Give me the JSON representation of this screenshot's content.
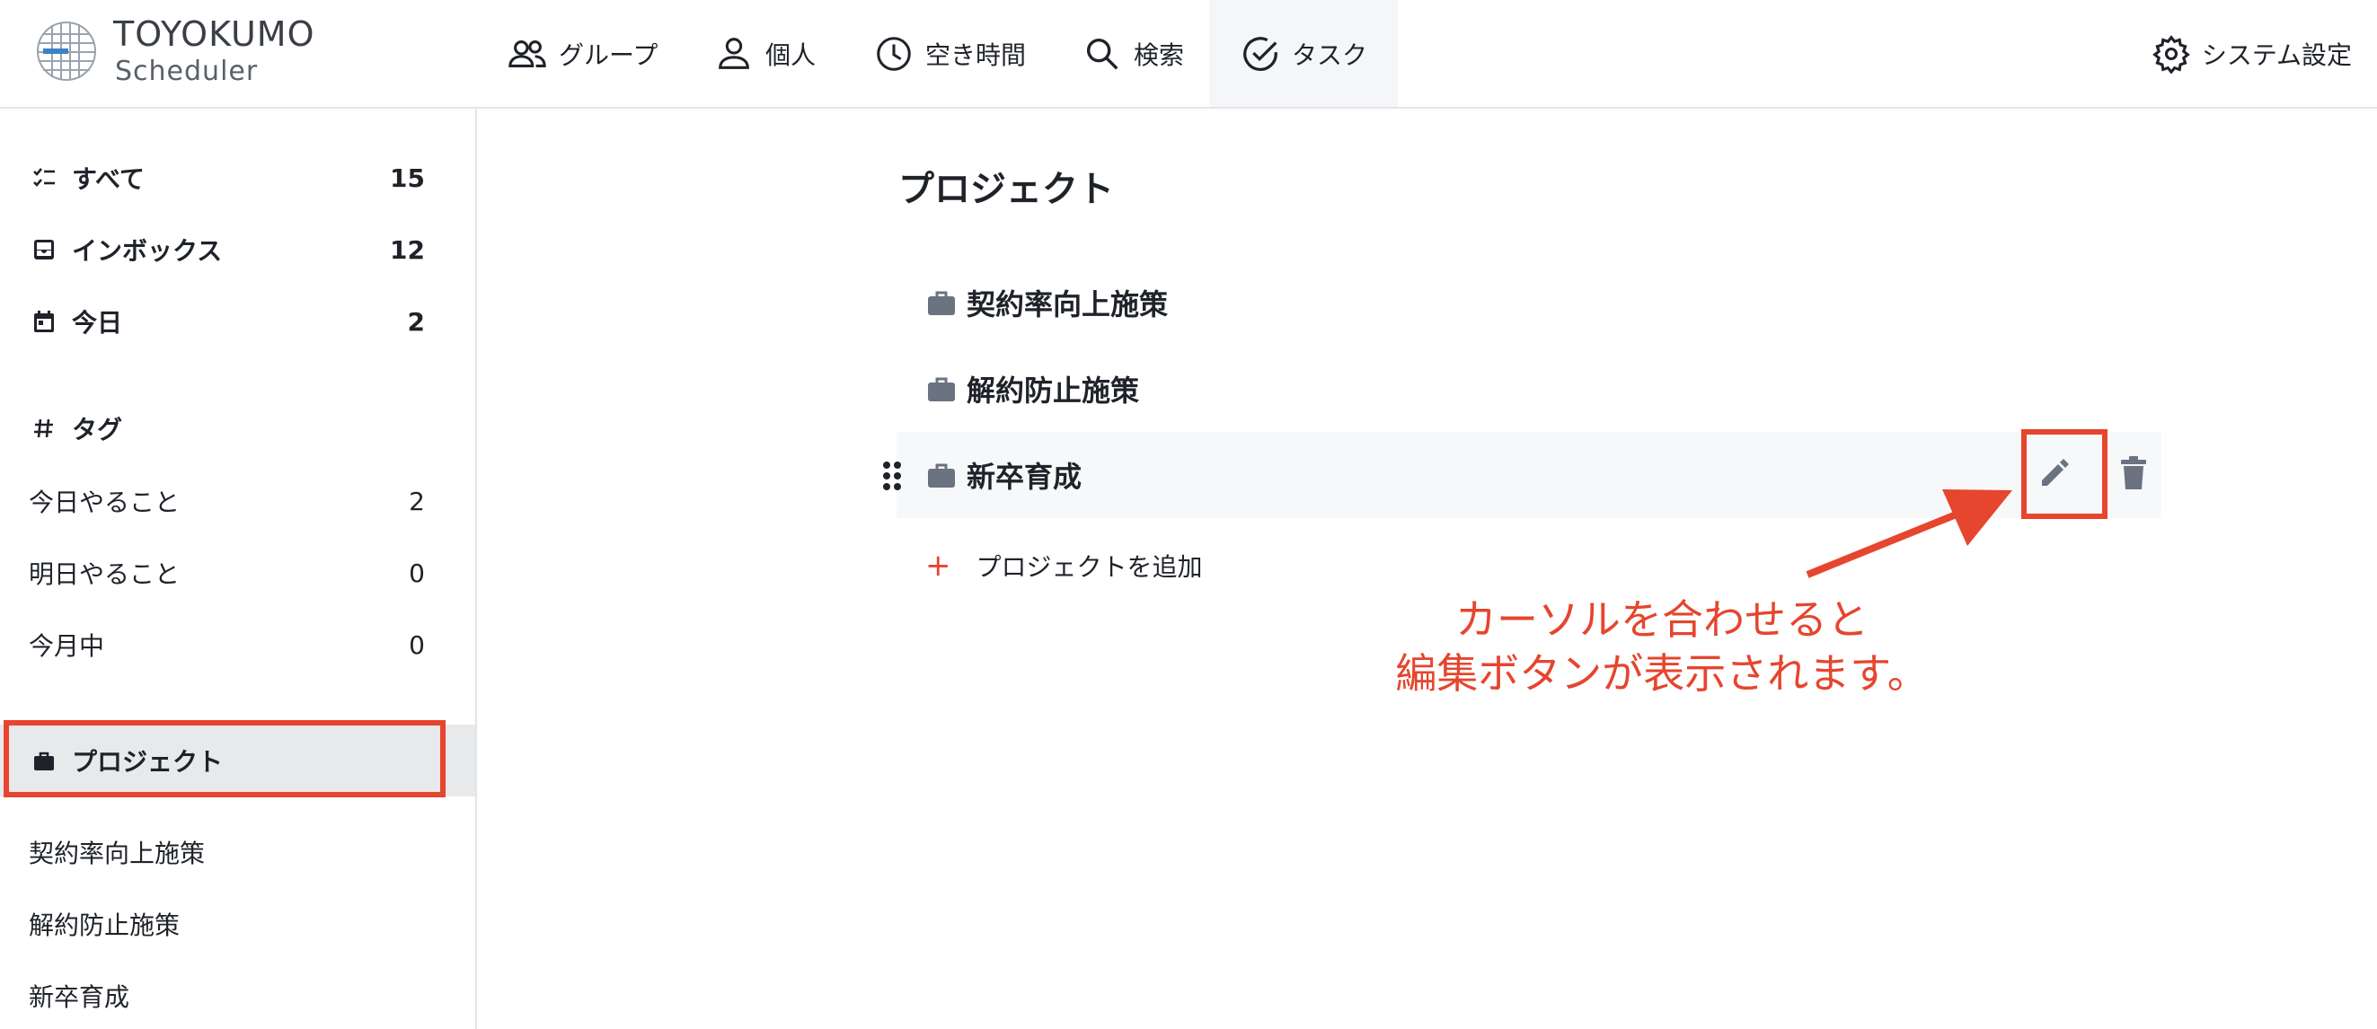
{
  "app": {
    "logo_title": "TOYOKUMO",
    "logo_subtitle": "Scheduler"
  },
  "nav": {
    "items": [
      {
        "label": "グループ",
        "icon": "group-icon"
      },
      {
        "label": "個人",
        "icon": "person-icon"
      },
      {
        "label": "空き時間",
        "icon": "clock-icon"
      },
      {
        "label": "検索",
        "icon": "search-icon"
      },
      {
        "label": "タスク",
        "icon": "check-circle-icon",
        "active": true
      }
    ],
    "settings_label": "システム設定"
  },
  "sidebar": {
    "filters": [
      {
        "label": "すべて",
        "count": "15",
        "icon": "checklist-icon"
      },
      {
        "label": "インボックス",
        "count": "12",
        "icon": "inbox-icon"
      },
      {
        "label": "今日",
        "count": "2",
        "icon": "calendar-icon"
      }
    ],
    "tags_heading": "タグ",
    "tags": [
      {
        "label": "今日やること",
        "count": "2"
      },
      {
        "label": "明日やること",
        "count": "0"
      },
      {
        "label": "今月中",
        "count": "0"
      }
    ],
    "projects_heading": "プロジェクト",
    "projects": [
      "契約率向上施策",
      "解約防止施策",
      "新卒育成"
    ]
  },
  "main": {
    "title": "プロジェクト",
    "projects": [
      "契約率向上施策",
      "解約防止施策",
      "新卒育成"
    ],
    "add_label": "プロジェクトを追加",
    "add_symbol": "+"
  },
  "annotation": {
    "line1": "カーソルを合わせると",
    "line2": "編集ボタンが表示されます。"
  },
  "colors": {
    "accent": "#e6452e",
    "icon_gray": "#6b7280",
    "selected_bg": "#e8e9eb",
    "hover_bg": "#f7f8f9"
  }
}
